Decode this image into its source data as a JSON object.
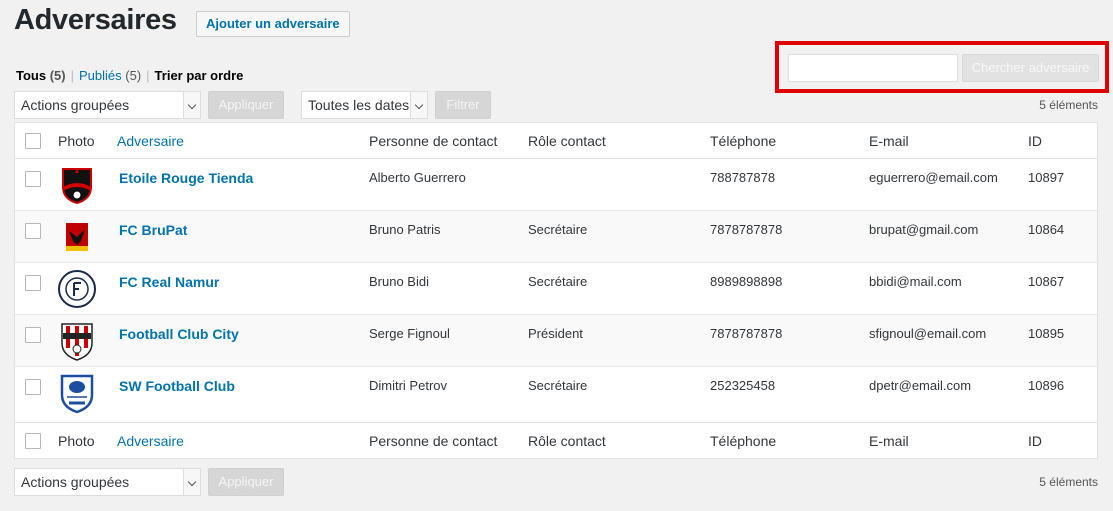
{
  "header": {
    "title": "Adversaires",
    "add_button": "Ajouter un adversaire"
  },
  "views": {
    "all_label": "Tous",
    "all_count": "(5)",
    "published_label": "Publiés",
    "published_count": "(5)",
    "separator": "|",
    "order_label": "Trier par ordre"
  },
  "search": {
    "value": "",
    "button": "Chercher adversaire"
  },
  "top_nav": {
    "bulk_actions": "Actions groupées",
    "apply": "Appliquer",
    "dates": "Toutes les dates",
    "filter": "Filtrer",
    "count": "5 éléments"
  },
  "bottom_nav": {
    "bulk_actions": "Actions groupées",
    "apply": "Appliquer",
    "count": "5 éléments"
  },
  "columns": {
    "photo": "Photo",
    "name": "Adversaire",
    "contact": "Personne de contact",
    "role": "Rôle contact",
    "phone": "Téléphone",
    "email": "E-mail",
    "id": "ID"
  },
  "rows": [
    {
      "name": "Etoile Rouge Tienda",
      "contact": "Alberto Guerrero",
      "role": "",
      "phone": "788787878",
      "email": "eguerrero@email.com",
      "id": "10897",
      "logo": "tienda-crest-icon"
    },
    {
      "name": "FC BruPat",
      "contact": "Bruno Patris",
      "role": "Secrétaire",
      "phone": "7878787878",
      "email": "brupat@gmail.com",
      "id": "10864",
      "logo": "crows-crest-icon"
    },
    {
      "name": "FC Real Namur",
      "contact": "Bruno Bidi",
      "role": "Secrétaire",
      "phone": "8989898898",
      "email": "bbidi@mail.com",
      "id": "10867",
      "logo": "real-crest-icon"
    },
    {
      "name": "Football Club City",
      "contact": "Serge Fignoul",
      "role": "Président",
      "phone": "7878787878",
      "email": "sfignoul@email.com",
      "id": "10895",
      "logo": "derby-crest-icon"
    },
    {
      "name": "SW Football Club",
      "contact": "Dimitri Petrov",
      "role": "Secrétaire",
      "phone": "252325458",
      "email": "dpetr@email.com",
      "id": "10896",
      "logo": "swfc-crest-icon"
    }
  ],
  "colors": {
    "link": "#0073aa",
    "highlight": "#e00000"
  }
}
